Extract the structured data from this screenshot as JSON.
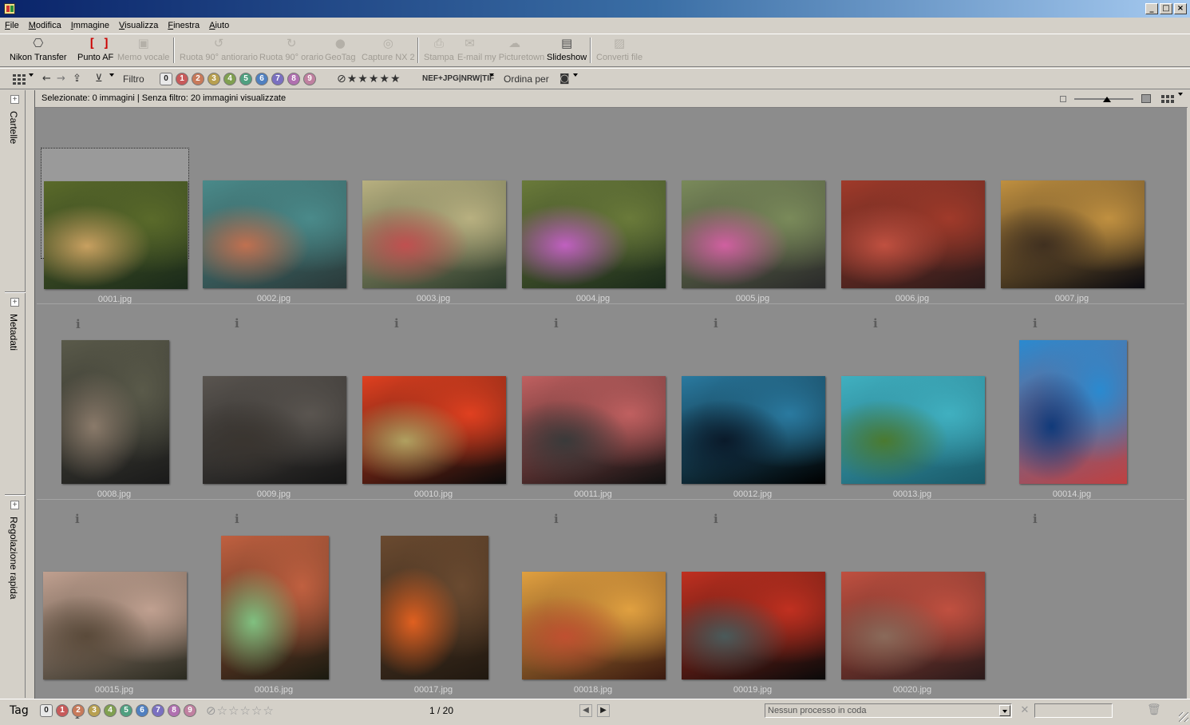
{
  "menu": [
    "File",
    "Modifica",
    "Immagine",
    "Visualizza",
    "Finestra",
    "Aiuto"
  ],
  "toolbar": [
    {
      "label": "Nikon Transfer",
      "icon": "camera-transfer-icon",
      "enabled": true
    },
    {
      "label": "Punto AF",
      "icon": "af-point-icon",
      "enabled": true
    },
    {
      "label": "Memo vocale",
      "icon": "voice-memo-icon",
      "enabled": false
    },
    {
      "label": "Ruota 90° antiorario",
      "icon": "rotate-ccw-icon",
      "enabled": false
    },
    {
      "label": "Ruota 90° orario",
      "icon": "rotate-cw-icon",
      "enabled": false
    },
    {
      "label": "GeoTag",
      "icon": "geotag-icon",
      "enabled": false
    },
    {
      "label": "Capture NX 2",
      "icon": "capture-nx-icon",
      "enabled": false
    },
    {
      "label": "Stampa",
      "icon": "print-icon",
      "enabled": false
    },
    {
      "label": "E-mail",
      "icon": "email-icon",
      "enabled": false
    },
    {
      "label": "my Picturetown",
      "icon": "picturetown-icon",
      "enabled": false
    },
    {
      "label": "Slideshow",
      "icon": "slideshow-icon",
      "enabled": true
    },
    {
      "label": "Converti file",
      "icon": "convert-file-icon",
      "enabled": false
    }
  ],
  "filterbar": {
    "filter_label": "Filtro",
    "rating_tags": [
      "0",
      "1",
      "2",
      "3",
      "4",
      "5",
      "6",
      "7",
      "8",
      "9"
    ],
    "star_filter": "★★★★★",
    "file_types": "NEF+JPG|NRW|TIF",
    "sort_label": "Ordina per"
  },
  "tag_colors": [
    "#e8e8e8",
    "#c85a5a",
    "#c87a5a",
    "#b8a050",
    "#80a050",
    "#50a080",
    "#5080c0",
    "#7a70c0",
    "#b070b0",
    "#c080a0"
  ],
  "side_tabs": [
    "Cartelle",
    "Metadati",
    "Regolazione rapida"
  ],
  "status": {
    "selection": "Selezionate: 0 immagini | Senza filtro: 20 immagini visualizzate"
  },
  "thumbnails": [
    {
      "name": "0001.jpg",
      "colors": [
        "#5a6a2a",
        "#c8a060",
        "#1a2a1a"
      ]
    },
    {
      "name": "0002.jpg",
      "colors": [
        "#4a8a8a",
        "#c07050",
        "#2a3a3a"
      ]
    },
    {
      "name": "0003.jpg",
      "colors": [
        "#b8b080",
        "#c05050",
        "#2a3a2a"
      ]
    },
    {
      "name": "0004.jpg",
      "colors": [
        "#6a7a3a",
        "#c060c0",
        "#1a2a1a"
      ]
    },
    {
      "name": "0005.jpg",
      "colors": [
        "#7a8a5a",
        "#d060a0",
        "#2a2a2a"
      ]
    },
    {
      "name": "0006.jpg",
      "colors": [
        "#a03a2a",
        "#c05040",
        "#2a1a1a"
      ]
    },
    {
      "name": "0007.jpg",
      "colors": [
        "#c09040",
        "#403020",
        "#0a0a10"
      ]
    },
    {
      "name": "0008.jpg",
      "colors": [
        "#5a5a4a",
        "#8a7a6a",
        "#1a1a1a"
      ]
    },
    {
      "name": "0009.jpg",
      "colors": [
        "#5a5550",
        "#3a3530",
        "#151515"
      ]
    },
    {
      "name": "00010.jpg",
      "colors": [
        "#e04020",
        "#b0a060",
        "#0a0a0a"
      ]
    },
    {
      "name": "00011.jpg",
      "colors": [
        "#c06060",
        "#3a3a3a",
        "#101010"
      ]
    },
    {
      "name": "00012.jpg",
      "colors": [
        "#2a7aa0",
        "#0a1a2a",
        "#000000"
      ]
    },
    {
      "name": "00013.jpg",
      "colors": [
        "#40b0c0",
        "#4a7a30",
        "#1a5a6a"
      ]
    },
    {
      "name": "00014.jpg",
      "colors": [
        "#2a8ad0",
        "#103a7a",
        "#c04040"
      ]
    },
    {
      "name": "00015.jpg",
      "colors": [
        "#c0a090",
        "#5a4a3a",
        "#2a2a20"
      ]
    },
    {
      "name": "00016.jpg",
      "colors": [
        "#c06040",
        "#80c080",
        "#1a1a10"
      ]
    },
    {
      "name": "00017.jpg",
      "colors": [
        "#6a4a30",
        "#e06020",
        "#201810"
      ]
    },
    {
      "name": "00018.jpg",
      "colors": [
        "#e0a040",
        "#c05030",
        "#3a1a10"
      ]
    },
    {
      "name": "00019.jpg",
      "colors": [
        "#c03020",
        "#4a5a5a",
        "#0a0a0a"
      ]
    },
    {
      "name": "00020.jpg",
      "colors": [
        "#c05040",
        "#8a6a5a",
        "#2a1a1a"
      ]
    }
  ],
  "bottombar": {
    "tag_label": "Tag",
    "page_counter": "1 / 20",
    "queue_status": "Nessun processo in coda"
  }
}
